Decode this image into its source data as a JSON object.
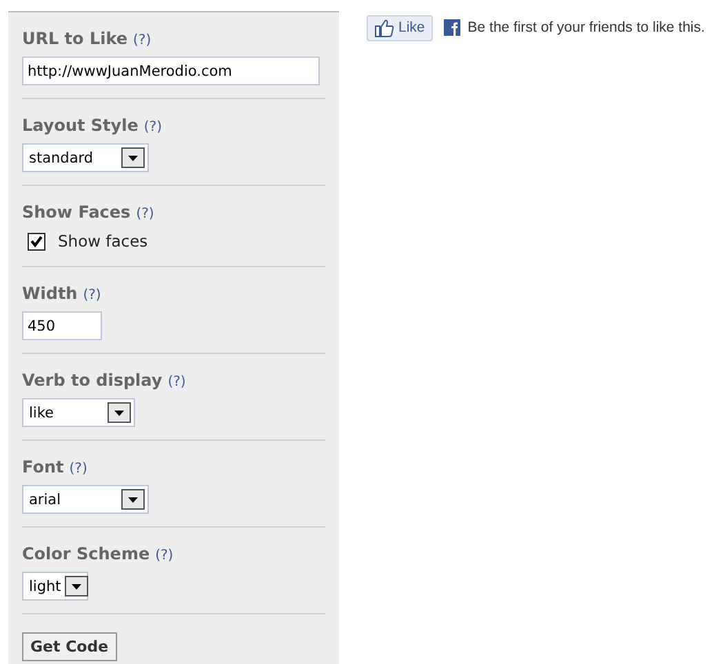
{
  "fields": [
    {
      "kind": "text",
      "label": "URL to Like",
      "help": "(?)",
      "value": "http://wwwJuanMerodio.com"
    },
    {
      "kind": "select",
      "label": "Layout Style",
      "help": "(?)",
      "value": "standard"
    },
    {
      "kind": "checkbox",
      "label": "Show Faces",
      "help": "(?)",
      "option": "Show faces",
      "checked": true
    },
    {
      "kind": "text",
      "label": "Width",
      "help": "(?)",
      "value": "450"
    },
    {
      "kind": "select",
      "label": "Verb to display",
      "help": "(?)",
      "value": "like"
    },
    {
      "kind": "select",
      "label": "Font",
      "help": "(?)",
      "value": "arial"
    },
    {
      "kind": "select",
      "label": "Color Scheme",
      "help": "(?)",
      "value": "light"
    }
  ],
  "submit": "Get Code",
  "preview": {
    "like_button": "Like",
    "message": "Be the first of your friends to like this."
  }
}
